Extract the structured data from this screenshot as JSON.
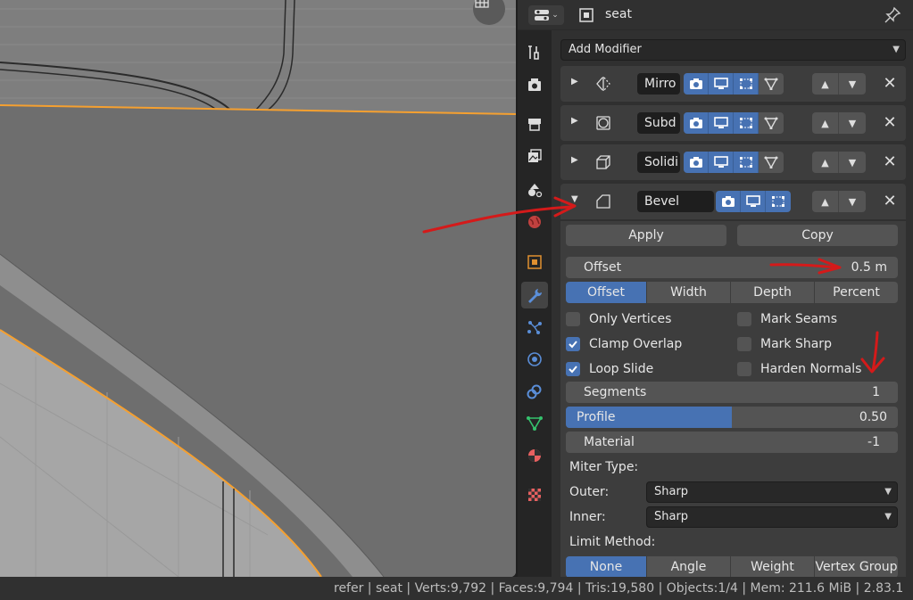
{
  "header": {
    "object_name": "seat",
    "editor_icon": "properties-editor-icon",
    "object_icon": "object-icon",
    "pin_icon": "pin-icon"
  },
  "tabs": [
    {
      "name": "tool-icon"
    },
    {
      "name": "render-icon"
    },
    {
      "name": "output-icon"
    },
    {
      "name": "view-layer-icon"
    },
    {
      "name": "scene-icon"
    },
    {
      "name": "world-icon"
    },
    {
      "name": "object-icon"
    },
    {
      "name": "modifier-wrench-icon",
      "active": true
    },
    {
      "name": "particles-icon"
    },
    {
      "name": "physics-icon"
    },
    {
      "name": "constraints-icon"
    },
    {
      "name": "object-data-icon"
    },
    {
      "name": "material-icon"
    },
    {
      "name": "texture-icon"
    }
  ],
  "add_modifier": "Add Modifier",
  "modifiers": [
    {
      "name": "Mirro",
      "icon": "mirror-icon",
      "expanded": false
    },
    {
      "name": "Subd",
      "icon": "subdivision-icon",
      "expanded": false
    },
    {
      "name": "Solidi",
      "icon": "solidify-icon",
      "expanded": false
    },
    {
      "name": "Bevel",
      "icon": "bevel-icon",
      "expanded": true
    }
  ],
  "bevel": {
    "apply_label": "Apply",
    "copy_label": "Copy",
    "offset_label": "Offset",
    "offset_value": "0.5 m",
    "width_types": [
      "Offset",
      "Width",
      "Depth",
      "Percent"
    ],
    "width_type_selected": "Offset",
    "checkboxes_left": [
      {
        "label": "Only Vertices",
        "checked": false
      },
      {
        "label": "Clamp Overlap",
        "checked": true
      },
      {
        "label": "Loop Slide",
        "checked": true
      }
    ],
    "checkboxes_right": [
      {
        "label": "Mark Seams",
        "checked": false
      },
      {
        "label": "Mark Sharp",
        "checked": false
      },
      {
        "label": "Harden Normals",
        "checked": false
      }
    ],
    "segments_label": "Segments",
    "segments_value": "1",
    "profile_label": "Profile",
    "profile_value": "0.50",
    "profile_fraction": 0.5,
    "material_label": "Material",
    "material_value": "-1",
    "miter_type_label": "Miter Type:",
    "outer_label": "Outer:",
    "outer_value": "Sharp",
    "inner_label": "Inner:",
    "inner_value": "Sharp",
    "limit_method_label": "Limit Method:",
    "limit_methods": [
      "None",
      "Angle",
      "Weight",
      "Vertex Group"
    ],
    "limit_method_selected": "None"
  },
  "status_bar": {
    "text": "refer | seat | Verts:9,792 | Faces:9,794 | Tris:19,580 | Objects:1/4 | Mem: 211.6 MiB | 2.83.1"
  },
  "colors": {
    "accent": "#4772b3",
    "annotation": "#d41a1a",
    "selection": "#f5a030"
  }
}
